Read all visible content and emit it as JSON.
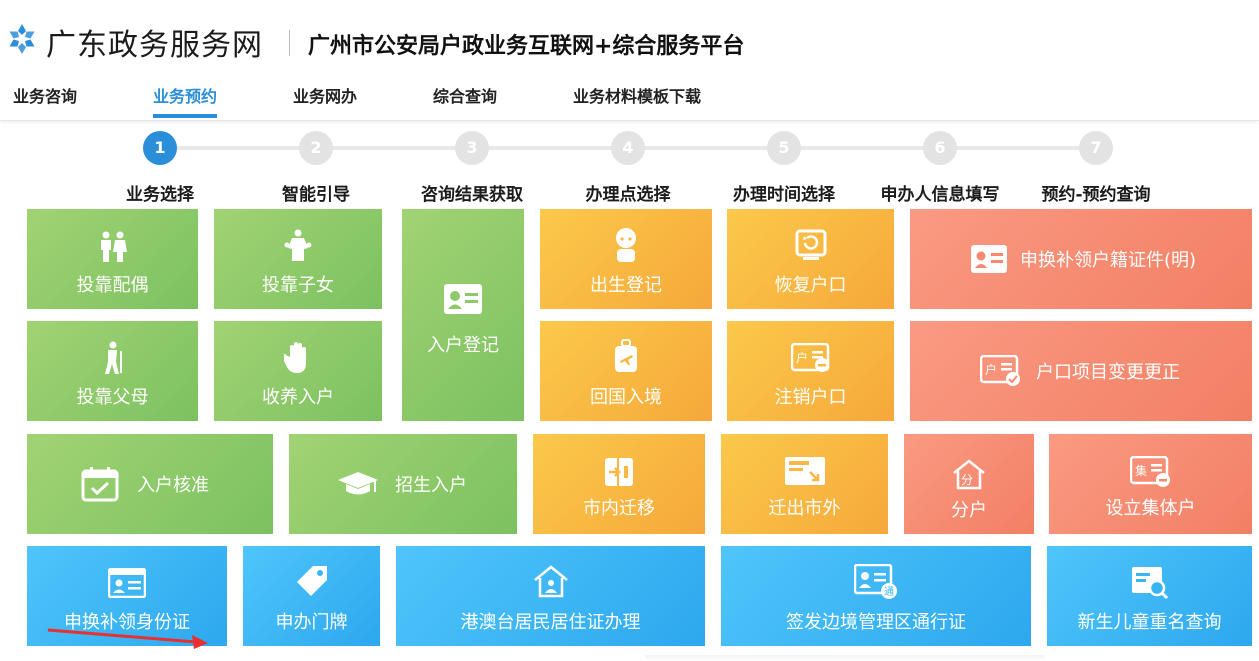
{
  "header": {
    "brand": "广东政务服务网",
    "platform": "广州市公安局户政业务互联网+综合服务平台"
  },
  "nav": {
    "items": [
      "业务咨询",
      "业务预约",
      "业务网办",
      "综合查询",
      "业务材料模板下载"
    ],
    "active": "业务预约"
  },
  "steps": [
    {
      "num": "1",
      "label": "业务选择",
      "active": true
    },
    {
      "num": "2",
      "label": "智能引导"
    },
    {
      "num": "3",
      "label": "咨询结果获取"
    },
    {
      "num": "4",
      "label": "办理点选择"
    },
    {
      "num": "5",
      "label": "办理时间选择"
    },
    {
      "num": "6",
      "label": "申办人信息填写"
    },
    {
      "num": "7",
      "label": "预约-预约查询"
    }
  ],
  "tiles": {
    "tk_spouse": "投靠配偶",
    "tk_child": "投靠子女",
    "household_reg": "入户登记",
    "birth_reg": "出生登记",
    "restore_hukou": "恢复户口",
    "replace_cert": "申换补领户籍证件(明)",
    "tk_parent": "投靠父母",
    "adoption": "收养入户",
    "return_home": "回国入境",
    "cancel_hukou": "注销户口",
    "hukou_change": "户口项目变更更正",
    "approval": "入户核准",
    "enrollment": "招生入户",
    "move_within": "市内迁移",
    "move_out": "迁出市外",
    "split_hh": "分户",
    "collective_hh": "设立集体户",
    "id_card": "申换补领身份证",
    "door_plate": "申办门牌",
    "hmt_permit": "港澳台居民居住证办理",
    "border_pass": "签发边境管理区通行证",
    "newborn_name": "新生儿童重名查询"
  },
  "colors": {
    "accent": "#2b8ed8",
    "green": "#8cc96a",
    "orange": "#f9b842",
    "salmon": "#f58a70",
    "blue": "#3ab5f4",
    "arrow": "#e8302f"
  }
}
